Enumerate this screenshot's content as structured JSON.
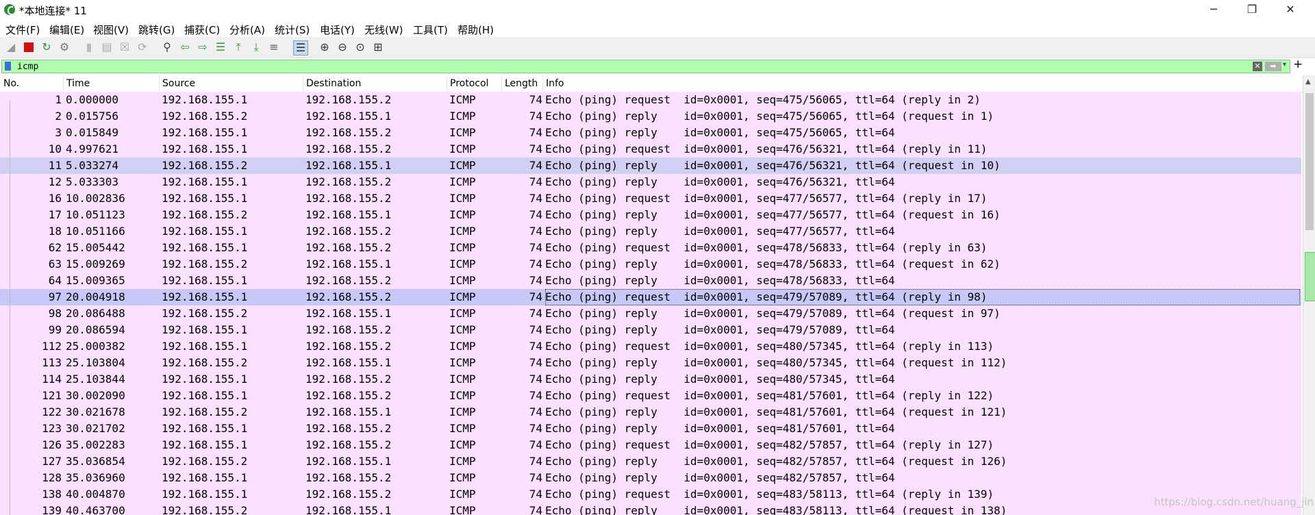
{
  "window": {
    "title": "*本地连接* 11",
    "minimize": "─",
    "restore": "❐",
    "close": "✕"
  },
  "menu": [
    "文件(F)",
    "编辑(E)",
    "视图(V)",
    "跳转(G)",
    "捕获(C)",
    "分析(A)",
    "统计(S)",
    "电话(Y)",
    "无线(W)",
    "工具(T)",
    "帮助(H)"
  ],
  "toolbar": {
    "icons": [
      "shark-fin-start-icon",
      "stop-capture-icon",
      "restart-capture-icon",
      "capture-options-icon",
      "open-file-icon",
      "save-file-icon",
      "close-file-icon",
      "reload-file-icon",
      "find-packet-icon",
      "go-back-icon",
      "go-forward-icon",
      "go-to-packet-icon",
      "first-packet-icon",
      "last-packet-icon",
      "autoscroll-icon",
      "colorize-icon",
      "zoom-in-icon",
      "zoom-out-icon",
      "zoom-normal-icon",
      "resize-columns-icon"
    ]
  },
  "filter": {
    "value": "icmp",
    "clear": "✕",
    "apply": "➡",
    "dropdown": "▾",
    "add": "+"
  },
  "columns": [
    "No.",
    "Time",
    "Source",
    "Destination",
    "Protocol",
    "Length",
    "Info"
  ],
  "rows": [
    [
      "1",
      "0.000000",
      "192.168.155.1",
      "192.168.155.2",
      "ICMP",
      "74",
      "Echo (ping) request  id=0x0001, seq=475/56065, ttl=64 (reply in 2)"
    ],
    [
      "2",
      "0.015756",
      "192.168.155.2",
      "192.168.155.1",
      "ICMP",
      "74",
      "Echo (ping) reply    id=0x0001, seq=475/56065, ttl=64 (request in 1)"
    ],
    [
      "3",
      "0.015849",
      "192.168.155.1",
      "192.168.155.2",
      "ICMP",
      "74",
      "Echo (ping) reply    id=0x0001, seq=475/56065, ttl=64"
    ],
    [
      "10",
      "4.997621",
      "192.168.155.1",
      "192.168.155.2",
      "ICMP",
      "74",
      "Echo (ping) request  id=0x0001, seq=476/56321, ttl=64 (reply in 11)"
    ],
    [
      "11",
      "5.033274",
      "192.168.155.2",
      "192.168.155.1",
      "ICMP",
      "74",
      "Echo (ping) reply    id=0x0001, seq=476/56321, ttl=64 (request in 10)"
    ],
    [
      "12",
      "5.033303",
      "192.168.155.1",
      "192.168.155.2",
      "ICMP",
      "74",
      "Echo (ping) reply    id=0x0001, seq=476/56321, ttl=64"
    ],
    [
      "16",
      "10.002836",
      "192.168.155.1",
      "192.168.155.2",
      "ICMP",
      "74",
      "Echo (ping) request  id=0x0001, seq=477/56577, ttl=64 (reply in 17)"
    ],
    [
      "17",
      "10.051123",
      "192.168.155.2",
      "192.168.155.1",
      "ICMP",
      "74",
      "Echo (ping) reply    id=0x0001, seq=477/56577, ttl=64 (request in 16)"
    ],
    [
      "18",
      "10.051166",
      "192.168.155.1",
      "192.168.155.2",
      "ICMP",
      "74",
      "Echo (ping) reply    id=0x0001, seq=477/56577, ttl=64"
    ],
    [
      "62",
      "15.005442",
      "192.168.155.1",
      "192.168.155.2",
      "ICMP",
      "74",
      "Echo (ping) request  id=0x0001, seq=478/56833, ttl=64 (reply in 63)"
    ],
    [
      "63",
      "15.009269",
      "192.168.155.2",
      "192.168.155.1",
      "ICMP",
      "74",
      "Echo (ping) reply    id=0x0001, seq=478/56833, ttl=64 (request in 62)"
    ],
    [
      "64",
      "15.009365",
      "192.168.155.1",
      "192.168.155.2",
      "ICMP",
      "74",
      "Echo (ping) reply    id=0x0001, seq=478/56833, ttl=64"
    ],
    [
      "97",
      "20.004918",
      "192.168.155.1",
      "192.168.155.2",
      "ICMP",
      "74",
      "Echo (ping) request  id=0x0001, seq=479/57089, ttl=64 (reply in 98)"
    ],
    [
      "98",
      "20.086488",
      "192.168.155.2",
      "192.168.155.1",
      "ICMP",
      "74",
      "Echo (ping) reply    id=0x0001, seq=479/57089, ttl=64 (request in 97)"
    ],
    [
      "99",
      "20.086594",
      "192.168.155.1",
      "192.168.155.2",
      "ICMP",
      "74",
      "Echo (ping) reply    id=0x0001, seq=479/57089, ttl=64"
    ],
    [
      "112",
      "25.000382",
      "192.168.155.1",
      "192.168.155.2",
      "ICMP",
      "74",
      "Echo (ping) request  id=0x0001, seq=480/57345, ttl=64 (reply in 113)"
    ],
    [
      "113",
      "25.103804",
      "192.168.155.2",
      "192.168.155.1",
      "ICMP",
      "74",
      "Echo (ping) reply    id=0x0001, seq=480/57345, ttl=64 (request in 112)"
    ],
    [
      "114",
      "25.103844",
      "192.168.155.1",
      "192.168.155.2",
      "ICMP",
      "74",
      "Echo (ping) reply    id=0x0001, seq=480/57345, ttl=64"
    ],
    [
      "121",
      "30.002090",
      "192.168.155.1",
      "192.168.155.2",
      "ICMP",
      "74",
      "Echo (ping) request  id=0x0001, seq=481/57601, ttl=64 (reply in 122)"
    ],
    [
      "122",
      "30.021678",
      "192.168.155.2",
      "192.168.155.1",
      "ICMP",
      "74",
      "Echo (ping) reply    id=0x0001, seq=481/57601, ttl=64 (request in 121)"
    ],
    [
      "123",
      "30.021702",
      "192.168.155.1",
      "192.168.155.2",
      "ICMP",
      "74",
      "Echo (ping) reply    id=0x0001, seq=481/57601, ttl=64"
    ],
    [
      "126",
      "35.002283",
      "192.168.155.1",
      "192.168.155.2",
      "ICMP",
      "74",
      "Echo (ping) request  id=0x0001, seq=482/57857, ttl=64 (reply in 127)"
    ],
    [
      "127",
      "35.036854",
      "192.168.155.2",
      "192.168.155.1",
      "ICMP",
      "74",
      "Echo (ping) reply    id=0x0001, seq=482/57857, ttl=64 (request in 126)"
    ],
    [
      "128",
      "35.036960",
      "192.168.155.1",
      "192.168.155.2",
      "ICMP",
      "74",
      "Echo (ping) reply    id=0x0001, seq=482/57857, ttl=64"
    ],
    [
      "138",
      "40.004870",
      "192.168.155.1",
      "192.168.155.2",
      "ICMP",
      "74",
      "Echo (ping) request  id=0x0001, seq=483/58113, ttl=64 (reply in 139)"
    ],
    [
      "139",
      "40.463700",
      "192.168.155.2",
      "192.168.155.1",
      "ICMP",
      "74",
      "Echo (ping) reply    id=0x0001, seq=483/58113, ttl=64 (request in 138)"
    ]
  ],
  "highlighted_row": 4,
  "selected_row": 12,
  "colors": {
    "row_bg": "#fce0ff",
    "selected_bg": "#c8c8f8",
    "filter_bg": "#afffaf"
  },
  "watermark": "https://blog.csdn.net/huang_jin"
}
